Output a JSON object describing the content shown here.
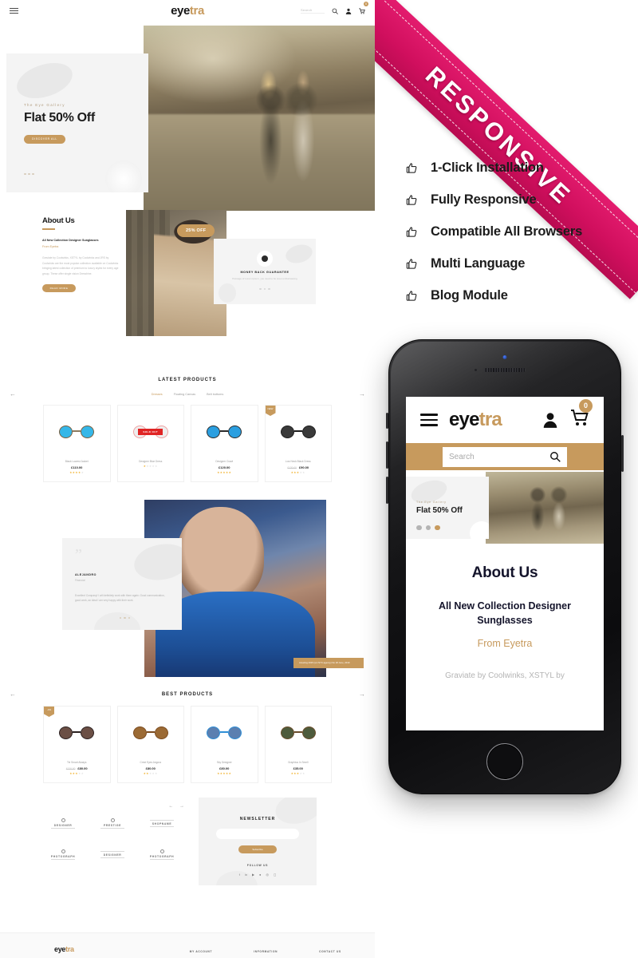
{
  "desktop": {
    "header": {
      "menu_icon": "hamburger-icon",
      "logo_dark": "eye",
      "logo_accent": "tra",
      "search_placeholder": "Search",
      "icons": [
        "search-icon",
        "account-icon",
        "cart-icon"
      ],
      "cart_count": "0"
    },
    "hero": {
      "eyebrow": "The Eye Gallery",
      "title": "Flat 50% Off",
      "button": "DISCOVER ALL"
    },
    "about": {
      "heading": "About Us",
      "subheading": "All New Collection Designer Sunglasses",
      "from": "From Eyetra",
      "body": "Graviate by Coolwinks, XSTYL by Coolwinks and JRS by Coolwinks are the most popular collection available on Coolwinks bringing latest collection of premium to luxury styles for every age group. These offer single vision Dresshine.",
      "button": "READ MORE",
      "badge": "25% OFF"
    },
    "guarantee": {
      "icon": "globe-icon",
      "title": "MONEY BACK GUARANTEE",
      "text": "Passage of Lorem Ipsum, you need to be sreet embarrassing"
    },
    "latest": {
      "title": "LATEST PRODUCTS",
      "tabs": [
        "Dresses",
        "Floating Canvas",
        "Belt bottoms"
      ],
      "active_tab": "Dresses",
      "prev_icon": "arrow-left-icon",
      "next_icon": "arrow-right-icon",
      "products": [
        {
          "name": "Black Lowest Jacket",
          "price": "£110.00",
          "old_price": "",
          "stars": 4,
          "tag": "",
          "sold_out": false,
          "lens": "#35b7e8",
          "frame": "#7a5c3a"
        },
        {
          "name": "Designer Blue Dress",
          "price": "",
          "old_price": "",
          "stars": 1,
          "tag": "",
          "sold_out": true,
          "lens": "#e8e8e8",
          "frame": "#f0a0a0"
        },
        {
          "name": "Designer Crawl",
          "price": "£120.00",
          "old_price": "",
          "stars": 5,
          "tag": "",
          "sold_out": false,
          "lens": "#2b9fe0",
          "frame": "#2a2a2a"
        },
        {
          "name": "Low Neck Black Dress",
          "price": "£90.00",
          "old_price": "£120.00",
          "stars": 3,
          "tag": "NEW",
          "sold_out": false,
          "lens": "#3a3a3a",
          "frame": "#1c1c1c"
        }
      ]
    },
    "testimonial": {
      "quote_mark": "”",
      "name": "ALEJANDRO",
      "role": "Financial",
      "text": "Excellent Company! I will definitely work with them again. Good communication, good work, an ideal I am very happy with their work.",
      "caption": "Amazing 2015 (s.k NYC agency) No 18 June, 2019"
    },
    "best": {
      "title": "BEST PRODUCTS",
      "prev_icon": "arrow-left-icon",
      "next_icon": "arrow-right-icon",
      "products": [
        {
          "name": "Tie Smart Always",
          "price": "£80.00",
          "old_price": "£120.00",
          "stars": 3,
          "tag": "-4%",
          "lens": "#6b4f45",
          "frame": "#2a2020"
        },
        {
          "name": "Crest Eyes Angora",
          "price": "£80.00",
          "old_price": "",
          "stars": 2,
          "tag": "",
          "lens": "#9b6a34",
          "frame": "#7a4a1e"
        },
        {
          "name": "Sky Designer",
          "price": "£80.00",
          "old_price": "",
          "stars": 5,
          "tag": "",
          "lens": "#5b7fb0",
          "frame": "#2f8fd6"
        },
        {
          "name": "Graphius In Smell",
          "price": "£35.00",
          "old_price": "",
          "stars": 3,
          "tag": "",
          "lens": "#4e5b3c",
          "frame": "#6a4c2a"
        }
      ]
    },
    "brands": {
      "prev_icon": "arrow-left-icon",
      "next_icon": "arrow-right-icon",
      "items": [
        "DESIGNER",
        "PRESTIGE",
        "SHOPNAME",
        "PHOTOGRAPH",
        "DESIGNER",
        "PHOTOGRAPH"
      ]
    },
    "newsletter": {
      "title": "NEWSLETTER",
      "input_placeholder": "",
      "button": "Subscribe",
      "follow_label": "FOLLOW US",
      "socials": [
        "facebook-icon",
        "linkedin-icon",
        "youtube-icon",
        "dribbble-icon",
        "pinterest-icon",
        "instagram-icon"
      ]
    },
    "footer": {
      "logo_dark": "eye",
      "logo_accent": "tra",
      "columns": [
        "MY ACCOUNT",
        "INFORMATION",
        "CONTACT US"
      ]
    }
  },
  "promo": {
    "ribbon_text": "RESPONSIVE",
    "ribbon_color": "#e31c6e",
    "features": [
      {
        "icon": "thumbs-up-icon",
        "label": "1-Click Installation"
      },
      {
        "icon": "thumbs-up-icon",
        "label": "Fully Responsive"
      },
      {
        "icon": "thumbs-up-icon",
        "label": "Compatible All Browsers"
      },
      {
        "icon": "thumbs-up-icon",
        "label": "Multi Language"
      },
      {
        "icon": "thumbs-up-icon",
        "label": "Blog Module"
      }
    ]
  },
  "phone": {
    "header": {
      "menu_icon": "hamburger-icon",
      "logo_dark": "eye",
      "logo_accent": "tra",
      "account_icon": "account-icon",
      "cart_icon": "cart-icon",
      "cart_count": "0"
    },
    "search": {
      "placeholder": "Search",
      "icon": "search-icon"
    },
    "hero": {
      "eyebrow": "The Eye Gallery",
      "title": "Flat 50% Off"
    },
    "about": {
      "heading": "About Us",
      "subheading": "All New Collection Designer Sunglasses",
      "from": "From Eyetra",
      "body": "Graviate by Coolwinks, XSTYL by"
    }
  }
}
